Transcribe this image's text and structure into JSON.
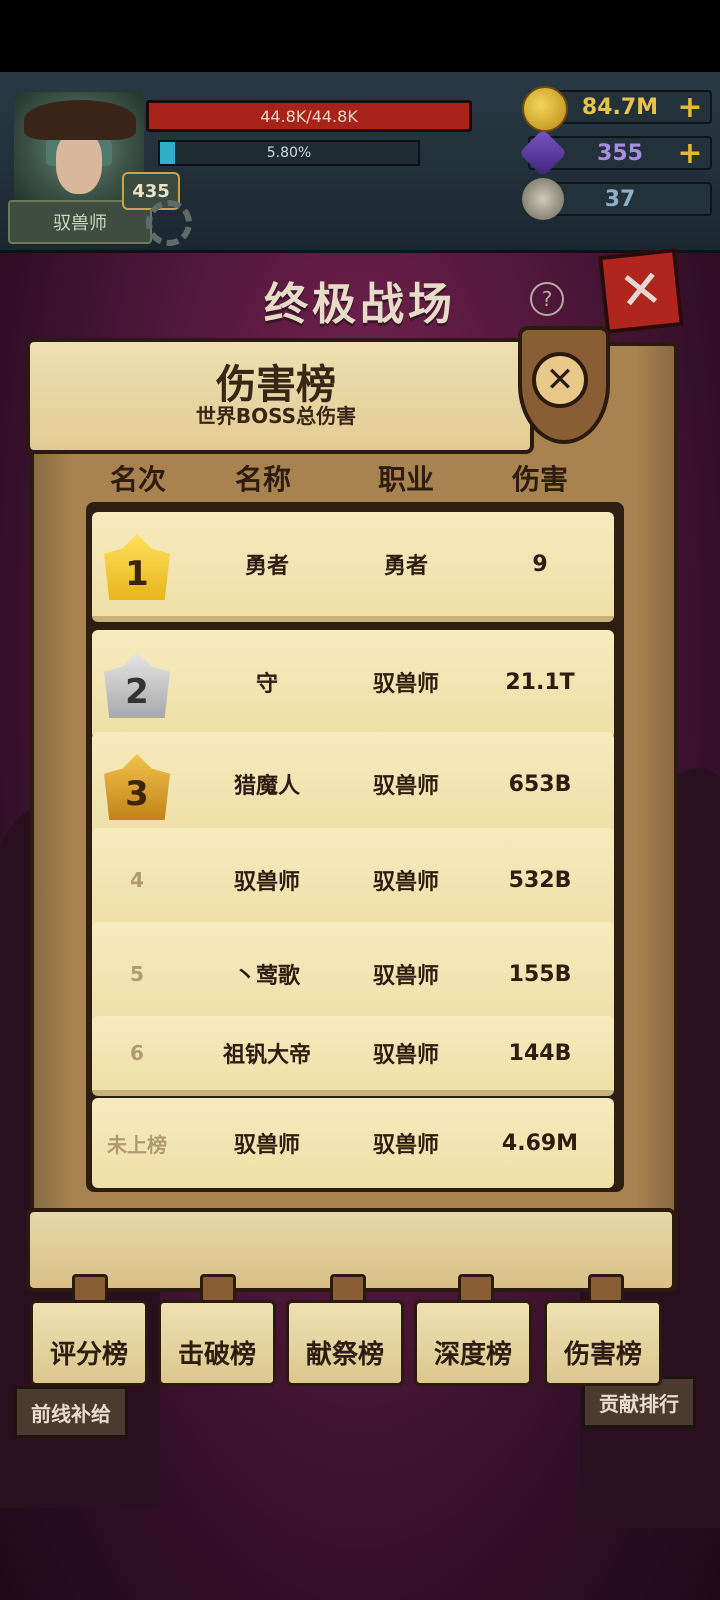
{
  "player": {
    "class_name": "驭兽师",
    "level": "435",
    "hp_text": "44.8K/44.8K",
    "hp_fraction": 1.0,
    "xp_text": "5.80%",
    "xp_fraction": 0.058
  },
  "resources": {
    "coins": "84.7M",
    "gems": "355",
    "keys": "37"
  },
  "scene": {
    "title": "终极战场",
    "help": "?",
    "close": "✕"
  },
  "board": {
    "title": "伤害榜",
    "subtitle": "世界BOSS总伤害",
    "close": "✕",
    "columns": [
      "名次",
      "名称",
      "职业",
      "伤害"
    ],
    "rows": [
      {
        "rank": "1",
        "name": "勇者",
        "job": "勇者",
        "damage": "9"
      },
      {
        "rank": "2",
        "name": "守",
        "job": "驭兽师",
        "damage": "21.1T"
      },
      {
        "rank": "3",
        "name": "猎魔人",
        "job": "驭兽师",
        "damage": "653B"
      },
      {
        "rank": "4",
        "name": "驭兽师",
        "job": "驭兽师",
        "damage": "532B"
      },
      {
        "rank": "5",
        "name": "丶莺歌",
        "job": "驭兽师",
        "damage": "155B"
      },
      {
        "rank": "6",
        "name": "祖钒大帝",
        "job": "驭兽师",
        "damage": "144B"
      }
    ],
    "self_row": {
      "rank": "未上榜",
      "name": "驭兽师",
      "job": "驭兽师",
      "damage": "4.69M"
    }
  },
  "tabs": [
    "评分榜",
    "击破榜",
    "献祭榜",
    "深度榜",
    "伤害榜"
  ],
  "side_buttons": {
    "left": "前线补给",
    "right": "贡献排行"
  }
}
